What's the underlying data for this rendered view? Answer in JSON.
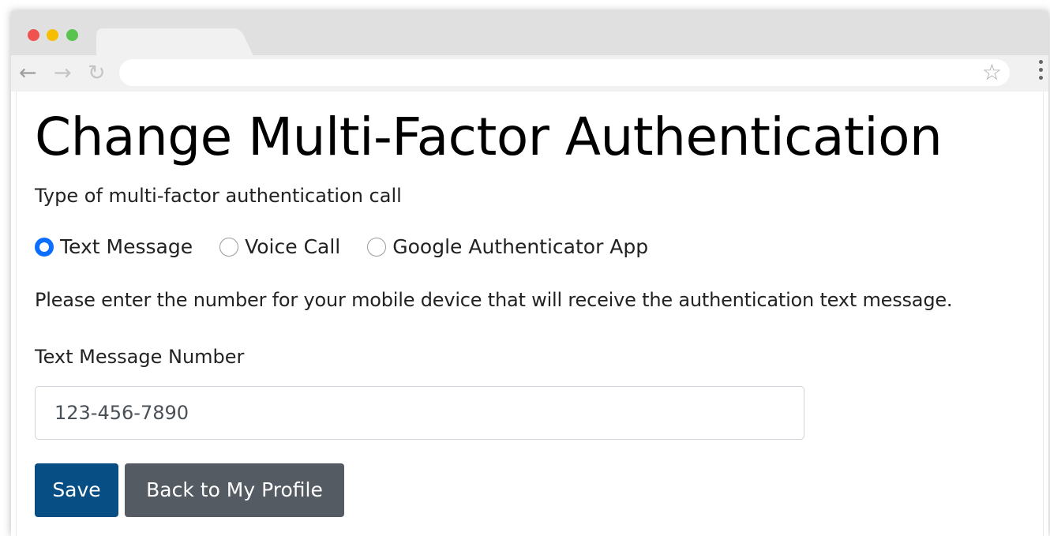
{
  "colors": {
    "close": "#f0524f",
    "minimize": "#f5be00",
    "maximize": "#58c44f",
    "radio_checked": "#0b6efd",
    "save_button": "#064e83",
    "back_button": "#555b62"
  },
  "browser": {
    "back_glyph": "←",
    "forward_glyph": "→",
    "reload_glyph": "↻",
    "star_glyph": "☆",
    "address": ""
  },
  "page": {
    "title": "Change Multi-Factor Authentication",
    "type_label": "Type of multi-factor authentication call",
    "options": [
      {
        "label": "Text Message",
        "checked": true
      },
      {
        "label": "Voice Call",
        "checked": false
      },
      {
        "label": "Google Authenticator App",
        "checked": false
      }
    ],
    "instructions": "Please enter the number for your mobile device that will receive the authentication text message.",
    "number_label": "Text Message Number",
    "number_value": "123-456-7890",
    "save_label": "Save",
    "back_label": "Back to My Profile"
  }
}
